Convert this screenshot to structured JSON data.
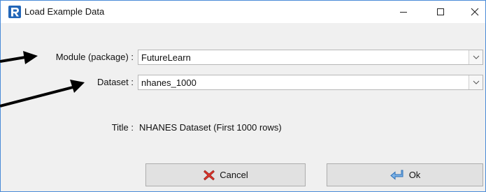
{
  "window": {
    "title": "Load Example Data",
    "app_icon": "r-logo-icon",
    "controls": {
      "minimize": "minimize-icon",
      "maximize": "maximize-icon",
      "close": "close-icon"
    }
  },
  "form": {
    "module_label": "Module (package) :",
    "module_value": "FutureLearn",
    "dataset_label": "Dataset :",
    "dataset_value": "nhanes_1000",
    "title_label": "Title :",
    "title_value": "NHANES Dataset (First 1000 rows)"
  },
  "buttons": {
    "cancel_label": "Cancel",
    "cancel_icon": "cancel-icon",
    "ok_label": "Ok",
    "ok_icon": "ok-arrow-icon"
  },
  "colors": {
    "accent_blue": "#4a8bd8",
    "cancel_icon_red": "#d9342b",
    "ok_icon_blue": "#4a90d9"
  }
}
